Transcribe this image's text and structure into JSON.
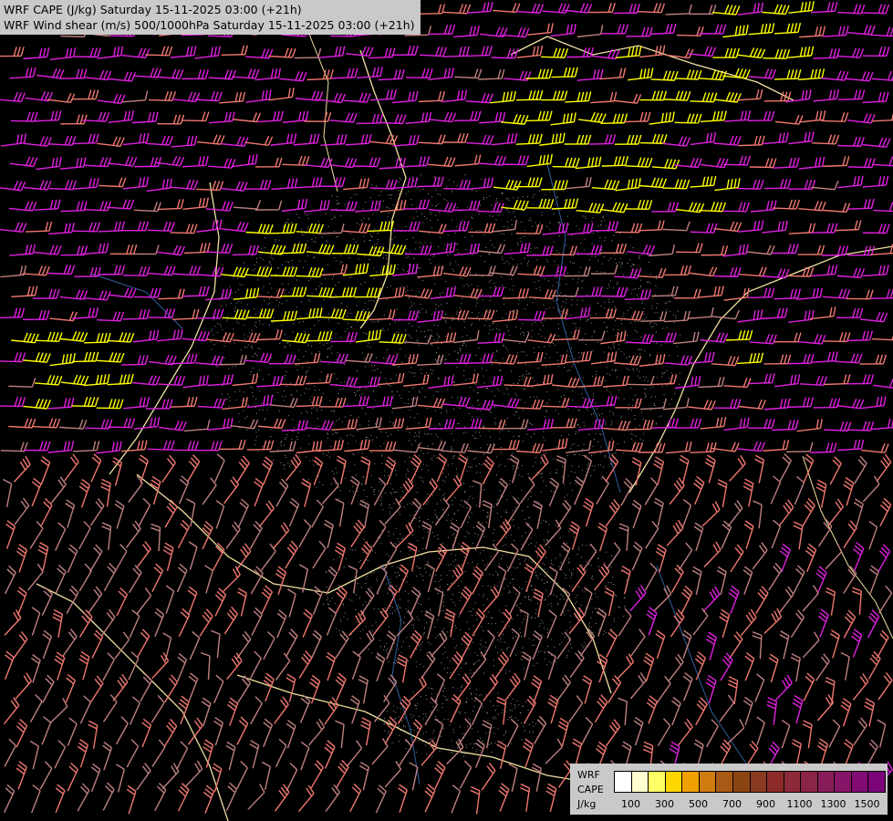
{
  "title": {
    "line1": "WRF CAPE (J/kg) Saturday 15-11-2025 03:00 (+21h)",
    "line2": "WRF Wind shear (m/s) 500/1000hPa Saturday 15-11-2025 03:00 (+21h)"
  },
  "legend": {
    "label_line1": "WRF",
    "label_line2": "CAPE",
    "label_line3": "J/kg",
    "colors": [
      "#ffffff",
      "#ffffd0",
      "#ffff66",
      "#ffd700",
      "#f0a000",
      "#d07b10",
      "#a85a14",
      "#8b4513",
      "#8a3a20",
      "#8c2a2a",
      "#8c2a3a",
      "#8a2448",
      "#881c58",
      "#861468",
      "#820c74",
      "#7a0478"
    ],
    "ticks": [
      "100",
      "300",
      "500",
      "700",
      "900",
      "1100",
      "1300",
      "1500"
    ]
  },
  "barb_colors": {
    "weak": "#c08080",
    "moderate": "#f07870",
    "strong": "#e020e0",
    "extreme": "#ffff00"
  },
  "border_color": "#f0e0a0",
  "river_color": "#3060a0",
  "stipple_color": "#909090"
}
